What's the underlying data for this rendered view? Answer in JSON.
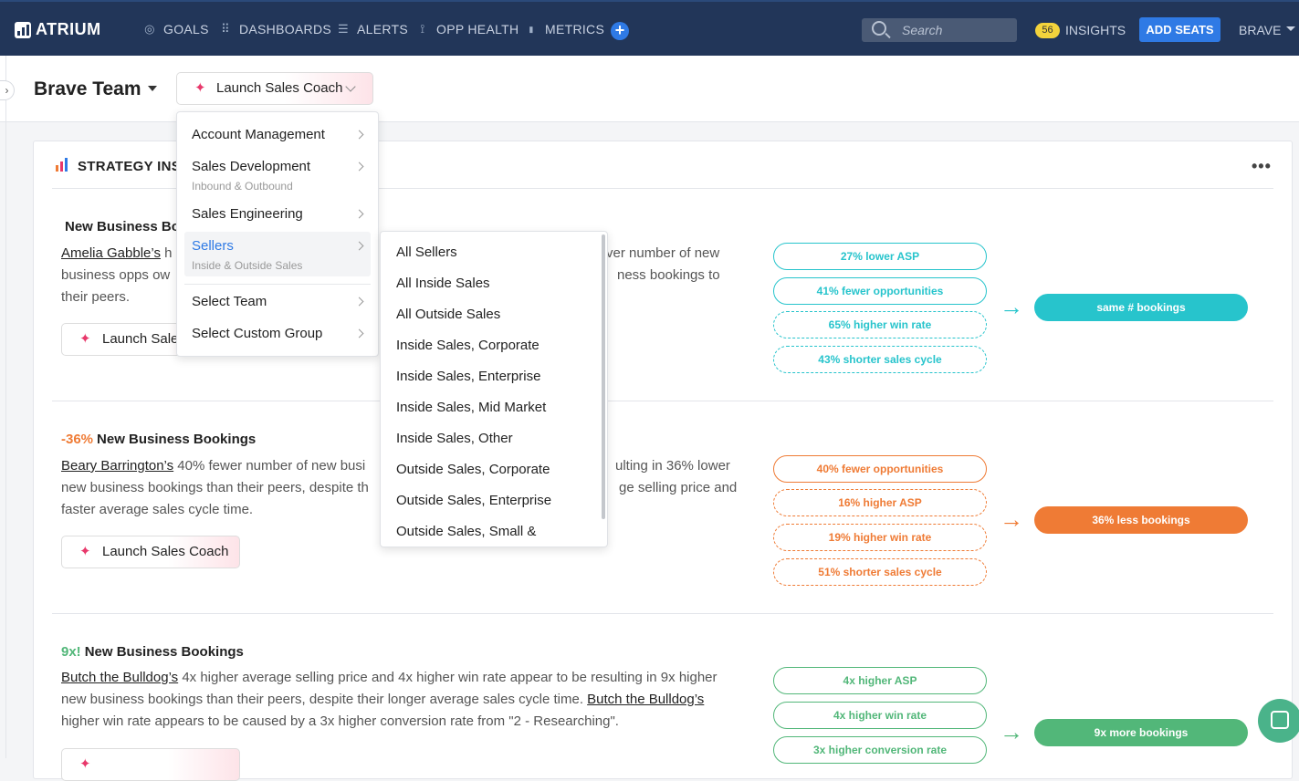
{
  "topbar": {
    "logo": "ATRIUM",
    "nav": [
      {
        "label": "GOALS",
        "icon": "target-icon",
        "glyph": "◎"
      },
      {
        "label": "DASHBOARDS",
        "icon": "grid-icon",
        "glyph": "⠿"
      },
      {
        "label": "ALERTS",
        "icon": "list-icon",
        "glyph": "☰"
      },
      {
        "label": "OPP HEALTH",
        "icon": "signal-icon",
        "glyph": "⟟"
      },
      {
        "label": "METRICS",
        "icon": "bar-chart-icon",
        "glyph": "▮"
      }
    ],
    "add": "+",
    "search_placeholder": "Search",
    "insights_count": "56",
    "insights_label": "INSIGHTS",
    "add_seats": "ADD SEATS",
    "user": "BRAVE"
  },
  "header": {
    "team": "Brave Team",
    "coach_button": "Launch Sales Coach"
  },
  "strategy": {
    "title": "STRATEGY INSIGHTS",
    "title_visible": "STRATEGY INS",
    "more": "•••"
  },
  "insights": [
    {
      "pct": "",
      "title": "New Business Bookings",
      "title_visible": "New Business Bo",
      "desc_lines": [
        {
          "name": "Amelia Gabble’s",
          "text": " h"
        },
        {
          "text": "business opps ow"
        },
        {
          "text": "their peers."
        }
      ],
      "desc_right": [
        "ver number of new",
        "ness bookings to"
      ],
      "button": "Launch Sales Coach",
      "button_visible": "Launch Sale",
      "pills": [
        "27% lower ASP",
        "41% fewer opportunities",
        "65% higher win rate",
        "43% shorter sales cycle"
      ],
      "result": "same # bookings",
      "color": "#27c4cc"
    },
    {
      "pct": "-36%",
      "title": "New Business Bookings",
      "desc_lines": [
        {
          "name": "Beary Barrington’s",
          "text": " 40% fewer number of new busi"
        },
        {
          "text": "new business bookings than their peers, despite th"
        },
        {
          "text": "faster average sales cycle time."
        }
      ],
      "desc_right": [
        "ulting in 36% lower",
        "ge selling price and"
      ],
      "button": "Launch Sales Coach",
      "pills": [
        "40% fewer opportunities",
        "16% higher ASP",
        "19% higher win rate",
        "51% shorter sales cycle"
      ],
      "result": "36% less bookings",
      "color": "#ef7b35"
    },
    {
      "pct": "9x!",
      "title": "New Business Bookings",
      "desc_lines": [
        {
          "name": "Butch the Bulldog’s",
          "text": " 4x higher average selling price and 4x higher win rate appear to be resulting in 9x higher"
        },
        {
          "text": "new business bookings than their peers, despite their longer average sales cycle time. ",
          "name2": "Butch the Bulldog’s"
        },
        {
          "text": "higher win rate appears to be caused by a 3x higher conversion rate from \"2 - Researching\"."
        }
      ],
      "pills": [
        "4x higher ASP",
        "4x higher win rate",
        "3x higher conversion rate"
      ],
      "result": "9x more bookings",
      "color": "#52b779"
    }
  ],
  "menu": {
    "items": [
      {
        "label": "Account Management",
        "sub": ""
      },
      {
        "label": "Sales Development",
        "sub": "Inbound & Outbound"
      },
      {
        "label": "Sales Engineering",
        "sub": ""
      },
      {
        "label": "Sellers",
        "sub": "Inside & Outside Sales"
      },
      {
        "label": "Select Team",
        "sub": ""
      },
      {
        "label": "Select Custom Group",
        "sub": ""
      }
    ]
  },
  "submenu": {
    "items": [
      "All Sellers",
      "All Inside Sales",
      "All Outside Sales",
      "Inside Sales, Corporate",
      "Inside Sales, Enterprise",
      "Inside Sales, Mid Market",
      "Inside Sales, Other",
      "Outside Sales, Corporate",
      "Outside Sales, Enterprise",
      "Outside Sales, Small &"
    ]
  },
  "colors": {
    "topbar": "#223659",
    "accent": "#2f7ae5",
    "selected": "#2f7ae5",
    "spark": "#e8386b"
  }
}
